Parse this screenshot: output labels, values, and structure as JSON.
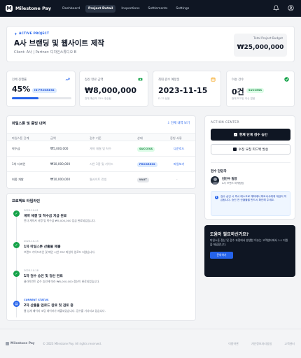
{
  "nav": {
    "brand": "Milestone Pay",
    "logo_char": "M",
    "links": [
      "Dashboard",
      "Project Detail",
      "Inspections",
      "Settlements",
      "Settings"
    ],
    "active_index": 1
  },
  "project": {
    "badge": "ACTIVE PROJECT",
    "title": "A사 브랜딩 및 웹사이트 제작",
    "client_line": "Client: A사 | Partner: 디자인스튜디오 B",
    "budget_label": "Total Project Budget",
    "budget_value": "₩25,000,000"
  },
  "stats": [
    {
      "label": "전체 진행률",
      "value": "45%",
      "badge": "IN PROGRESS",
      "sub": "",
      "progress_pct": 45
    },
    {
      "label": "정산 완료 금액",
      "value": "₩8,000,000",
      "badge": "",
      "sub": "전체 예산의 32% 정산됨"
    },
    {
      "label": "최대 검수 예정일",
      "value": "2023-11-15",
      "badge": "",
      "sub": "D-12 남음"
    },
    {
      "label": "이슈 건수",
      "value": "0건",
      "badge": "SUCCESS",
      "sub": "현재 보고된 이슈 없음"
    }
  ],
  "milestones": {
    "title": "마일스톤 및 증빙 내역",
    "link": "전체 내역 보기",
    "headers": [
      "마일스톤 단계",
      "금액",
      "검수 기준",
      "상태",
      "증빙 서류"
    ],
    "rows": [
      {
        "stage": "착수금",
        "amount": "₩5,000,000",
        "criteria": "계약 체결 및 착수",
        "status": "SUCCESS",
        "doc": "다운로드"
      },
      {
        "stage": "1차 디자인",
        "amount": "₩10,000,000",
        "criteria": "시안 3종 및 가이드",
        "status": "PROGRESS",
        "doc": "파일보기"
      },
      {
        "stage": "최종 개발",
        "amount": "₩10,000,000",
        "criteria": "웹사이트 런칭",
        "status": "WAIT",
        "doc": "-"
      }
    ]
  },
  "timeline": {
    "title": "프로젝트 타임라인",
    "events": [
      {
        "date": "2023-10-01",
        "title": "계약 체결 및 착수금 지급 완료",
        "desc": "전자 계약서 서명 및 착수금 ₩5,000,000 입금 완료되었습니다.",
        "state": "done"
      },
      {
        "date": "2023-10-15",
        "title": "1차 마일스톤 산출물 제출",
        "desc": "브랜드 가이드라인 및 메인 시안 PDF 파일이 업로드 되었습니다.",
        "state": "done"
      },
      {
        "date": "2023-10-18",
        "title": "1차 검수 승인 및 정산 완료",
        "desc": "클라이언트 검수 승인에 따라 ₩8,000,000 정산이 완료되었습니다.",
        "state": "done"
      },
      {
        "date": "CURRENT STATUS",
        "title": "2차 산출물 업로드 완료 및 검토 중",
        "desc": "웹 상세 페이지 코딩 데이터가 제출되었습니다. 검수를 기다리고 있습니다.",
        "state": "current"
      }
    ]
  },
  "action_center": {
    "title": "ACTION CENTER",
    "primary_button": "현재 단계 검수 승인",
    "secondary_button": "수정 요청 피드백 발송",
    "manager_label": "검수 담당자",
    "manager_name": "김민수 팀장",
    "manager_role": "A사 브랜드 마케팅팀",
    "notice": "검수 승인 시 즉시 에스크로 계좌에서 파트너사에게 대금이 지급됩니다. 승인 전 산출물을 반드시 확인해 주세요."
  },
  "help": {
    "title": "도움이 필요하신가요?",
    "text": "마일스톤 정산 및 검수 과정에서 발생한 이슈는 고객센터에서 1:1 지원을 제공합니다.",
    "button": "문의하기"
  },
  "footer": {
    "brand": "Milestone Pay",
    "copyright": "© 2023 Milestone Pay. All rights reserved.",
    "links": [
      "이용약관",
      "개인정보처리방침",
      "고객센터"
    ]
  },
  "colors": {
    "nav_bg": "#0f1623",
    "accent": "#2563eb",
    "success": "#16a34a",
    "warning": "#f59e0b"
  }
}
